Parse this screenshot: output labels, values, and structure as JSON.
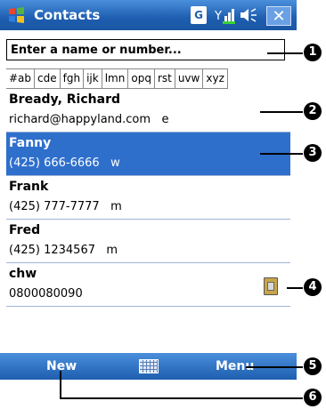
{
  "window": {
    "title": "Contacts",
    "status_icons": [
      "g-icon",
      "signal-icon",
      "volume-icon",
      "close-icon"
    ],
    "g_label": "G"
  },
  "search": {
    "placeholder": "Enter a name or number..."
  },
  "tabs": [
    "#ab",
    "cde",
    "fgh",
    "ijk",
    "lmn",
    "opq",
    "rst",
    "uvw",
    "xyz"
  ],
  "contacts": [
    {
      "name": "Bready, Richard",
      "detail": "richard@happyland.com   e",
      "selected": false,
      "sim": false
    },
    {
      "name": "Fanny",
      "detail": "(425) 666-6666   w",
      "selected": true,
      "sim": false
    },
    {
      "name": "Frank",
      "detail": "(425) 777-7777   m",
      "selected": false,
      "sim": false
    },
    {
      "name": "Fred",
      "detail": "(425) 1234567   m",
      "selected": false,
      "sim": false
    },
    {
      "name": "chw",
      "detail": "0800080090",
      "selected": false,
      "sim": true
    }
  ],
  "bottombar": {
    "left_soft_key": "New",
    "right_soft_key": "Menu"
  },
  "callouts": [
    "1",
    "2",
    "3",
    "4",
    "5",
    "6"
  ],
  "colors": {
    "titlebar": "#1e5eb0",
    "selected_row": "#2f6fcc"
  }
}
